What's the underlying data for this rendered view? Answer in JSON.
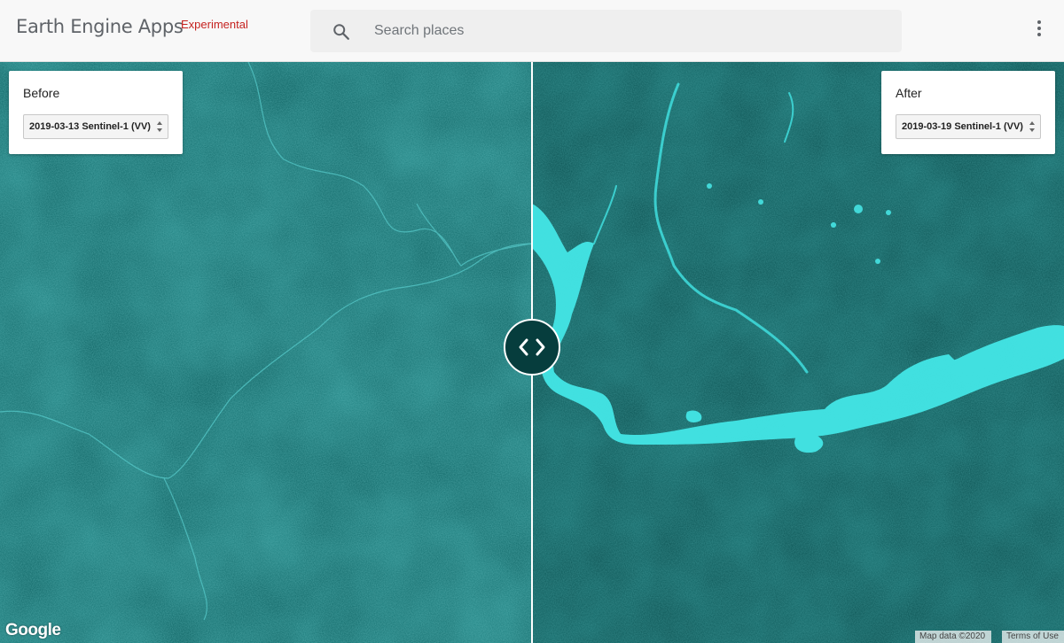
{
  "header": {
    "brand": "Earth Engine Apps",
    "brand_tag": "Experimental",
    "search_placeholder": "Search places",
    "icons": {
      "search": "search-icon",
      "menu": "more-vertical-icon"
    }
  },
  "panels": {
    "before": {
      "title": "Before",
      "selected": "2019-03-13 Sentinel-1 (VV)"
    },
    "after": {
      "title": "After",
      "selected": "2019-03-19 Sentinel-1 (VV)"
    }
  },
  "map": {
    "divider_icon": "swap-horizontal-icon",
    "base_color": "#0b5e5e",
    "water_color": "#3fe3e3"
  },
  "footer": {
    "logo": "Google",
    "map_data": "Map data ©2020",
    "terms": "Terms of Use"
  }
}
